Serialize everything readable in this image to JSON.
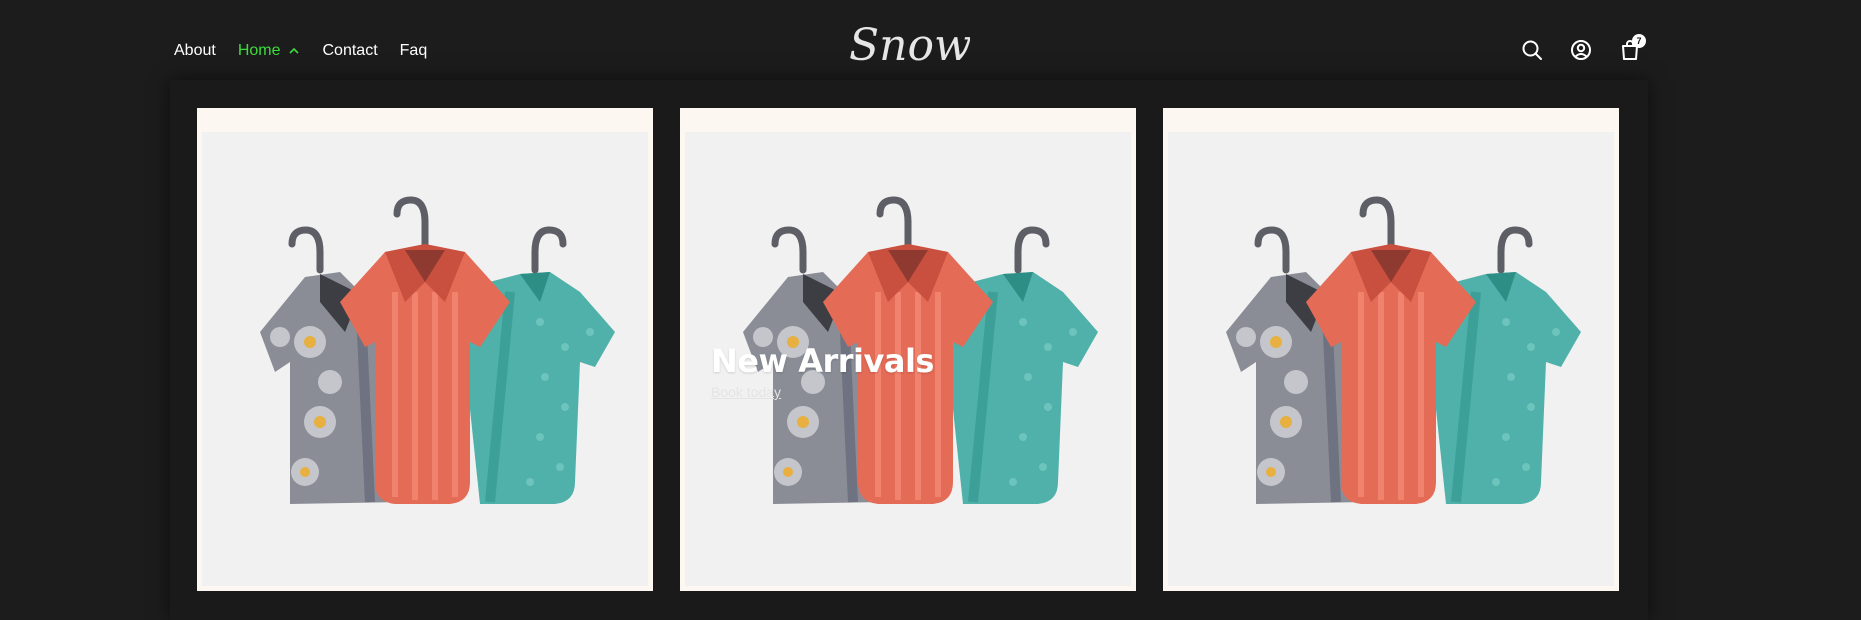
{
  "nav": {
    "items": [
      {
        "label": "About",
        "active": false
      },
      {
        "label": "Home",
        "active": true
      },
      {
        "label": "Contact",
        "active": false
      },
      {
        "label": "Faq",
        "active": false
      }
    ]
  },
  "brand": {
    "logo_text": "Snow"
  },
  "header_icons": [
    "search-icon",
    "account-icon",
    "cart-icon"
  ],
  "cart": {
    "count": "7"
  },
  "colors": {
    "background": "#1c1c1c",
    "nav_active": "#3ddc3d",
    "card_background": "#fdf7f2",
    "image_background": "#f1f1f1"
  },
  "cards": [
    {
      "image": "shirts-on-hangers-illustration",
      "title": "",
      "link": ""
    },
    {
      "image": "shirts-on-hangers-illustration",
      "title": "New Arrivals",
      "link": "Book today"
    },
    {
      "image": "shirts-on-hangers-illustration",
      "title": "",
      "link": ""
    }
  ]
}
